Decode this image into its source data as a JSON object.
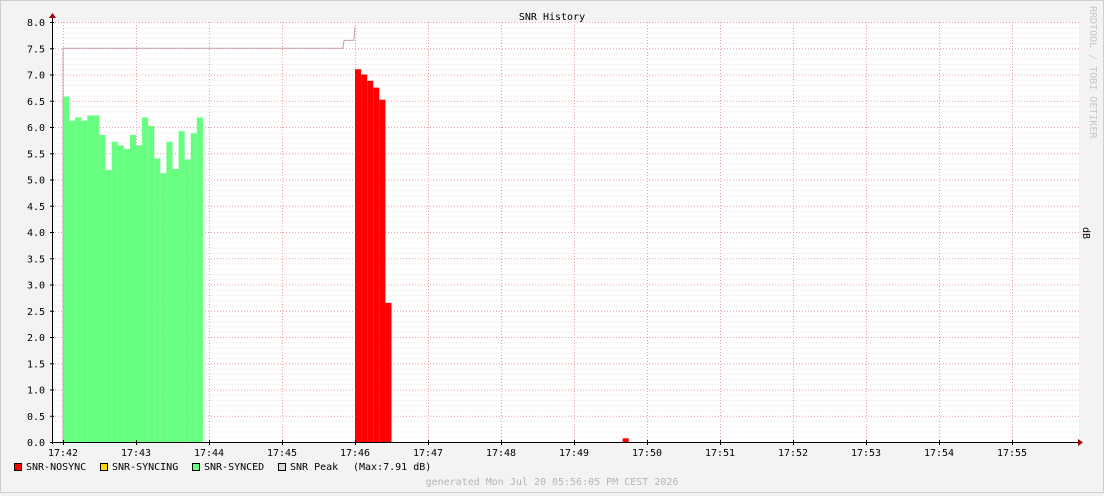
{
  "chart_data": {
    "type": "area",
    "title": "SNR History",
    "ylabel": "dB",
    "vertical_label": "RRDTOOL / TOBI OETIKER",
    "ylim": [
      0,
      8.0
    ],
    "y_ticks": [
      "0.0",
      "0.5",
      "1.0",
      "1.5",
      "2.0",
      "2.5",
      "3.0",
      "3.5",
      "4.0",
      "4.5",
      "5.0",
      "5.5",
      "6.0",
      "6.5",
      "7.0",
      "7.5",
      "8.0"
    ],
    "x_ticks": [
      "17:42",
      "17:43",
      "17:44",
      "17:45",
      "17:46",
      "17:47",
      "17:48",
      "17:49",
      "17:50",
      "17:51",
      "17:52",
      "17:53",
      "17:54",
      "17:55"
    ],
    "grid": true,
    "legend_position": "bottom-left",
    "series": [
      {
        "name": "SNR-NOSYNC",
        "color": "#ff0000",
        "points": [
          {
            "x": "17:46:00",
            "y": 7.1
          },
          {
            "x": "17:46:05",
            "y": 7.0
          },
          {
            "x": "17:46:10",
            "y": 6.88
          },
          {
            "x": "17:46:15",
            "y": 6.75
          },
          {
            "x": "17:46:20",
            "y": 6.52
          },
          {
            "x": "17:46:25",
            "y": 2.65
          },
          {
            "x": "17:46:30",
            "y": 0.0
          },
          {
            "x": "17:49:40",
            "y": 0.07
          },
          {
            "x": "17:49:45",
            "y": 0.0
          }
        ]
      },
      {
        "name": "SNR-SYNCING",
        "color": "#ffd700",
        "points": []
      },
      {
        "name": "SNR-SYNCED",
        "color": "#66ff80",
        "points": [
          {
            "x": "17:42:00",
            "y": 6.58
          },
          {
            "x": "17:42:05",
            "y": 6.12
          },
          {
            "x": "17:42:10",
            "y": 6.18
          },
          {
            "x": "17:42:15",
            "y": 6.12
          },
          {
            "x": "17:42:20",
            "y": 6.22
          },
          {
            "x": "17:42:25",
            "y": 6.22
          },
          {
            "x": "17:42:30",
            "y": 5.85
          },
          {
            "x": "17:42:35",
            "y": 5.18
          },
          {
            "x": "17:42:40",
            "y": 5.72
          },
          {
            "x": "17:42:45",
            "y": 5.65
          },
          {
            "x": "17:42:50",
            "y": 5.58
          },
          {
            "x": "17:42:55",
            "y": 5.85
          },
          {
            "x": "17:43:00",
            "y": 5.65
          },
          {
            "x": "17:43:05",
            "y": 6.18
          },
          {
            "x": "17:43:10",
            "y": 6.02
          },
          {
            "x": "17:43:15",
            "y": 5.4
          },
          {
            "x": "17:43:20",
            "y": 5.12
          },
          {
            "x": "17:43:25",
            "y": 5.72
          },
          {
            "x": "17:43:30",
            "y": 5.2
          },
          {
            "x": "17:43:35",
            "y": 5.92
          },
          {
            "x": "17:43:40",
            "y": 5.38
          },
          {
            "x": "17:43:45",
            "y": 5.88
          },
          {
            "x": "17:43:50",
            "y": 6.18
          },
          {
            "x": "17:43:55",
            "y": 0.0
          }
        ]
      },
      {
        "name": "SNR Peak",
        "color": "#c8a0a8",
        "points": [
          {
            "x": "17:42:00",
            "y": 7.5
          },
          {
            "x": "17:45:50",
            "y": 7.5
          },
          {
            "x": "17:45:51",
            "y": 7.65
          },
          {
            "x": "17:45:59",
            "y": 7.65
          },
          {
            "x": "17:46:00",
            "y": 7.91
          }
        ]
      }
    ],
    "legend": [
      {
        "label": "SNR-NOSYNC",
        "color": "#ff0000"
      },
      {
        "label": "SNR-SYNCING",
        "color": "#ffd700"
      },
      {
        "label": "SNR-SYNCED",
        "color": "#66ff80"
      },
      {
        "label": "SNR Peak",
        "color": "#d8d8d8"
      }
    ],
    "legend_extra": "(Max:7.91 dB)",
    "footer": "generated Mon Jul 20 05:56:05 PM CEST 2026"
  }
}
